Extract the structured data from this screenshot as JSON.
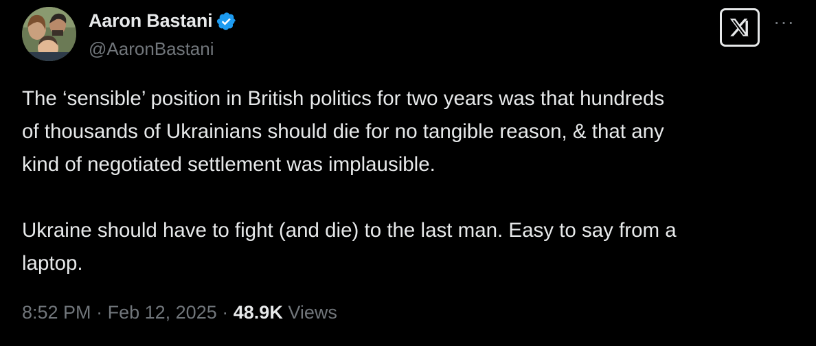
{
  "tweet": {
    "author_name": "Aaron Bastani",
    "handle": "@AaronBastani",
    "text": "The ‘sensible’ position in British politics for two years was that hundreds\nof thousands of Ukrainians should die for no tangible reason, & that any\nkind of negotiated settlement was implausible.\n\nUkraine should have to fight (and die) to the last man. Easy to say from a\nlaptop.",
    "time": "8:52 PM",
    "date": "Feb 12, 2025",
    "separator": "·",
    "views_count": "48.9K",
    "views_label": "Views"
  },
  "icons": {
    "verified": "verified-badge-icon",
    "x_logo": "x-logo-icon",
    "more": "more-icon"
  },
  "more_label": "···",
  "colors": {
    "background": "#000000",
    "text": "#e7e9ea",
    "secondary": "#71767b",
    "verified": "#1d9bf0"
  }
}
